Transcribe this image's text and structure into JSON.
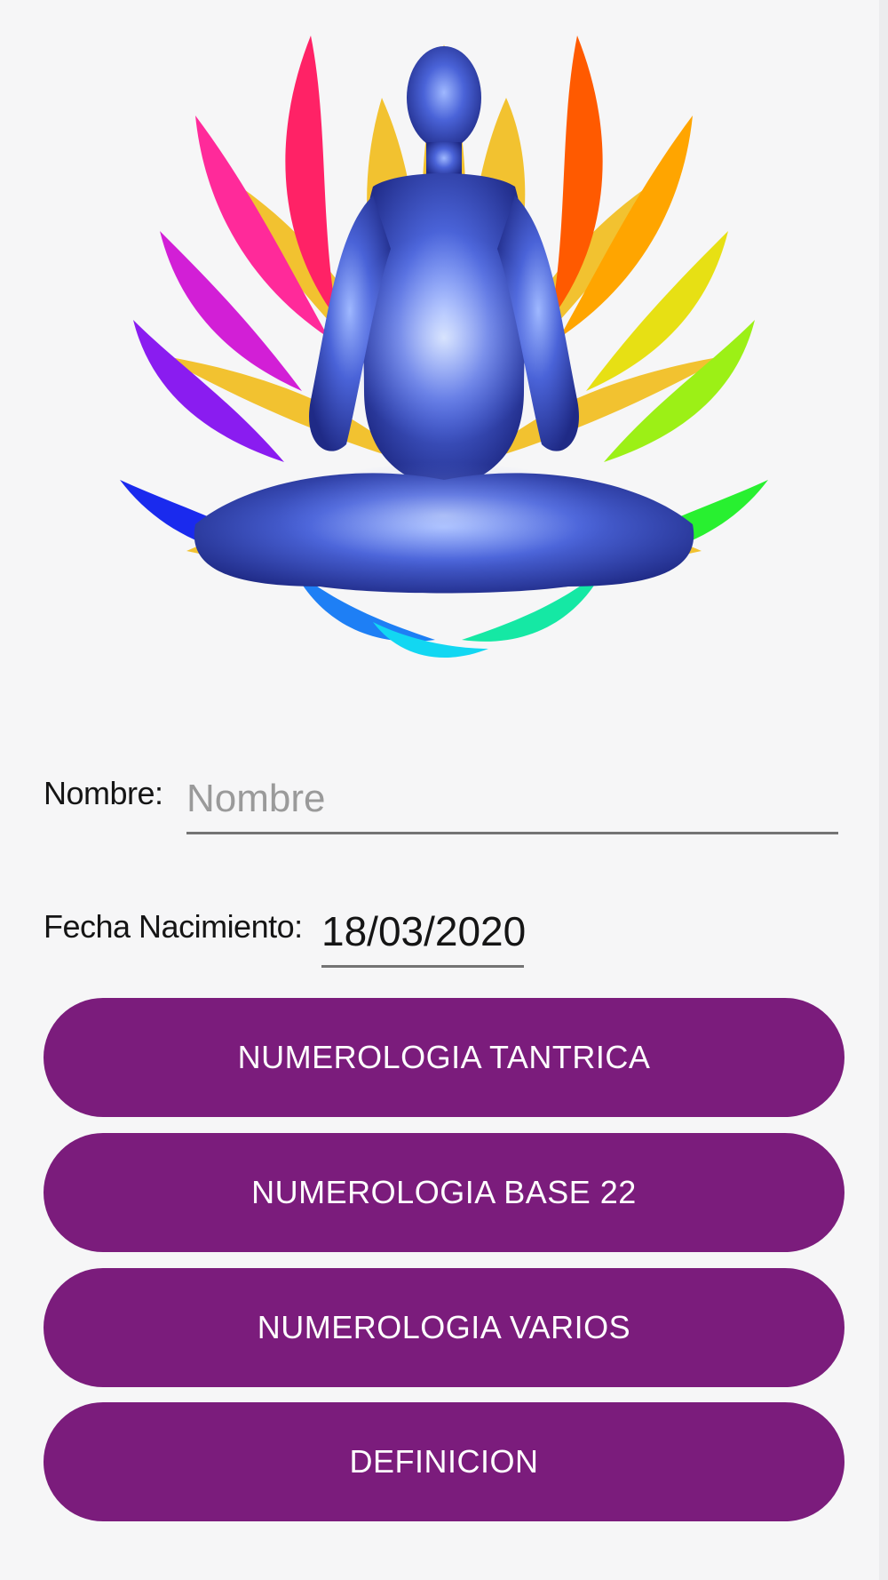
{
  "form": {
    "name_label": "Nombre:",
    "name_placeholder": "Nombre",
    "name_value": "",
    "date_label": "Fecha Nacimiento:",
    "date_value": "18/03/2020"
  },
  "buttons": [
    {
      "label": "NUMEROLOGIA TANTRICA"
    },
    {
      "label": "NUMEROLOGIA BASE 22"
    },
    {
      "label": "NUMEROLOGIA VARIOS"
    },
    {
      "label": "DEFINICION"
    }
  ],
  "colors": {
    "button_bg": "#7b1c7c",
    "button_text": "#ffffff",
    "background": "#f6f6f7",
    "underline": "#747474"
  }
}
